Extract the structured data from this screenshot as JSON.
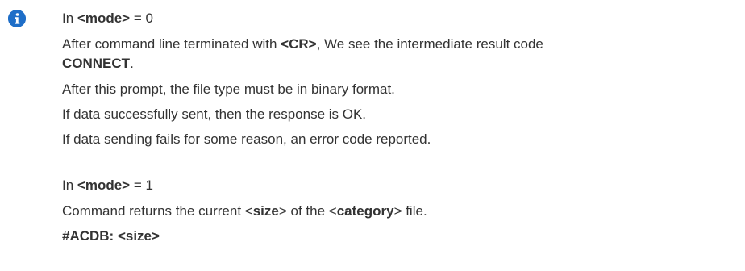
{
  "icon": {
    "name": "info-icon",
    "color": "#1e6ec8"
  },
  "mode0": {
    "prefix": "In ",
    "keyword": "<mode>",
    "value": " = 0",
    "p1_before": "After command line terminated with ",
    "p1_bold": "<CR>",
    "p1_after": ", We see the intermediate result code",
    "p1_line2": "CONNECT",
    "p1_line2_after": ".",
    "p2": "After this prompt, the file type must be in binary format.",
    "p3": "If data successfully sent, then the response is OK.",
    "p4": "If data sending fails for some reason, an error code reported."
  },
  "mode1": {
    "prefix": "In ",
    "keyword": "<mode>",
    "value": " = 1",
    "p1_a": "Command returns the current <",
    "p1_b": "size",
    "p1_c": "> of the <",
    "p1_d": "category",
    "p1_e": "> file.",
    "response": "#ACDB: <size>"
  }
}
